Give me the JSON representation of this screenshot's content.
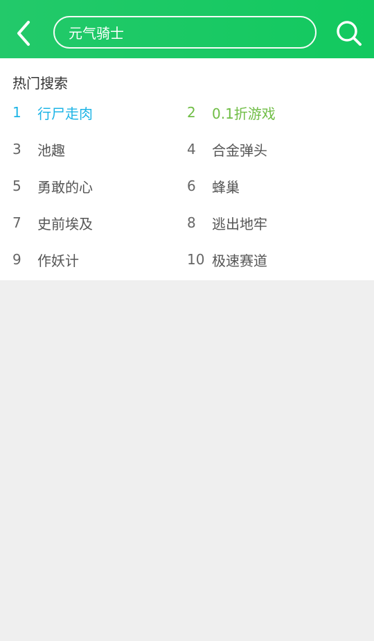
{
  "colors": {
    "header_bg": "#1dc964",
    "rank1": "#1db4e6",
    "rank2": "#6fbd45",
    "text": "#555555",
    "page_bg": "#efefef"
  },
  "header": {
    "back_icon": "chevron-left-icon",
    "search": {
      "value": "元气骑士",
      "placeholder": ""
    },
    "search_icon": "search-icon"
  },
  "hot": {
    "title": "热门搜索",
    "items": [
      {
        "rank": "1",
        "label": "行尸走肉",
        "color": "#1db4e6"
      },
      {
        "rank": "2",
        "label": "0.1折游戏",
        "color": "#6fbd45"
      },
      {
        "rank": "3",
        "label": "池趣",
        "color": "#555555"
      },
      {
        "rank": "4",
        "label": "合金弹头",
        "color": "#555555"
      },
      {
        "rank": "5",
        "label": "勇敢的心",
        "color": "#555555"
      },
      {
        "rank": "6",
        "label": "蜂巢",
        "color": "#555555"
      },
      {
        "rank": "7",
        "label": "史前埃及",
        "color": "#555555"
      },
      {
        "rank": "8",
        "label": "逃出地牢",
        "color": "#555555"
      },
      {
        "rank": "9",
        "label": "作妖计",
        "color": "#555555"
      },
      {
        "rank": "10",
        "label": "极速赛道",
        "color": "#555555"
      }
    ]
  }
}
